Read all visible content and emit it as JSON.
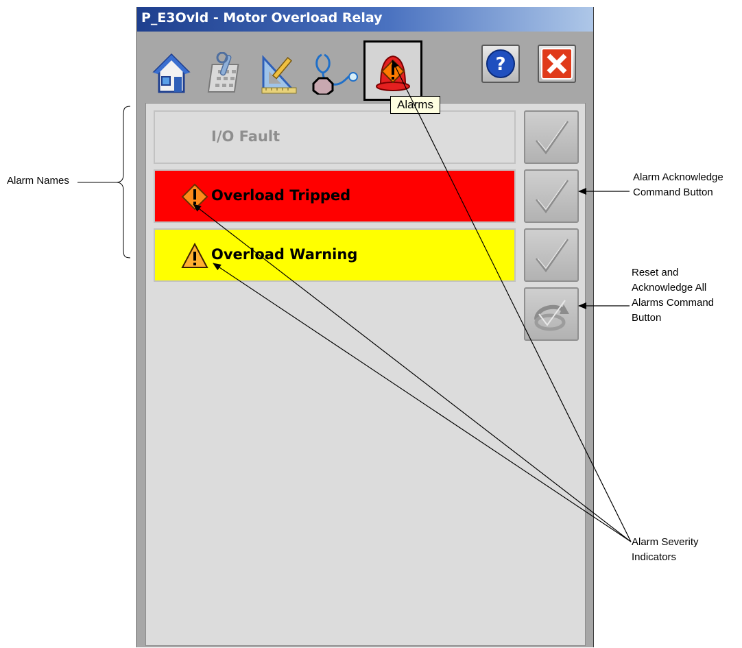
{
  "window": {
    "title": "P_E3Ovld - Motor Overload Relay"
  },
  "toolbar": {
    "icons": [
      "home-icon",
      "maintenance-icon",
      "engineering-icon",
      "diagnostics-icon",
      "alarms-icon",
      "help-icon",
      "close-icon"
    ],
    "selected": "alarms",
    "tooltip": "Alarms",
    "colors": {
      "help": "#1f4fbf",
      "close": "#e03a1a"
    }
  },
  "alarms": [
    {
      "name": "I/O Fault",
      "state": "inactive",
      "row_color": "#dcdcdc",
      "text_color": "#8e8e8e",
      "severity_icon": ""
    },
    {
      "name": "Overload Tripped",
      "state": "active",
      "row_color": "#ff0000",
      "text_color": "#000000",
      "severity_icon": "diamond-exclamation-icon"
    },
    {
      "name": "Overload Warning",
      "state": "active",
      "row_color": "#ffff00",
      "text_color": "#000000",
      "severity_icon": "triangle-exclamation-icon"
    }
  ],
  "callouts": {
    "alarm_names": "Alarm Names",
    "ack_button": [
      "Alarm Acknowledge",
      "Command Button"
    ],
    "reset_button": [
      "Reset and",
      "Acknowledge All",
      "Alarms Command",
      "Button"
    ],
    "severity": [
      "Alarm Severity",
      "Indicators"
    ]
  }
}
